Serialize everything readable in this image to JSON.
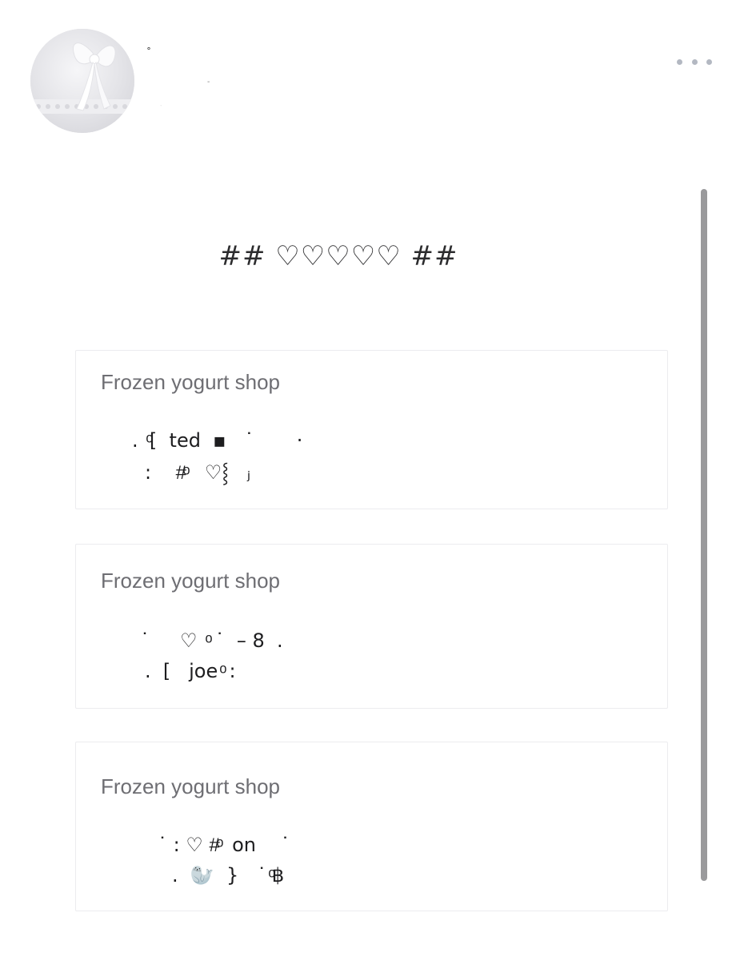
{
  "header": {
    "dot_a": "˚",
    "dot_b": "-",
    "dot_c": "ˑ",
    "more_icon": "more-horizontal-icon"
  },
  "heading": "## ♡♡♡♡♡ ##",
  "cards": [
    {
      "title": "Frozen yogurt shop",
      "lines": [
        ".  ͦ[  ted  ▪   ˙       ·",
        ":    #ͦ   ♡⸾   ⱼ"
      ]
    },
    {
      "title": "Frozen yogurt shop",
      "lines": [
        "˙     ♡  ͦ ˙  – 8  .",
        ".  [   joe ͦ :"
      ]
    },
    {
      "title": "Frozen yogurt shop",
      "lines": [
        "˙ : ♡ #ͦ  on    ˙",
        ".  🦭  }   ˙ ͦ฿"
      ]
    }
  ],
  "colors": {
    "card_title": "#6e6e73",
    "card_border": "#ececef",
    "scrollbar": "#9a9a9c",
    "more_dots": "#b3b8c2"
  }
}
